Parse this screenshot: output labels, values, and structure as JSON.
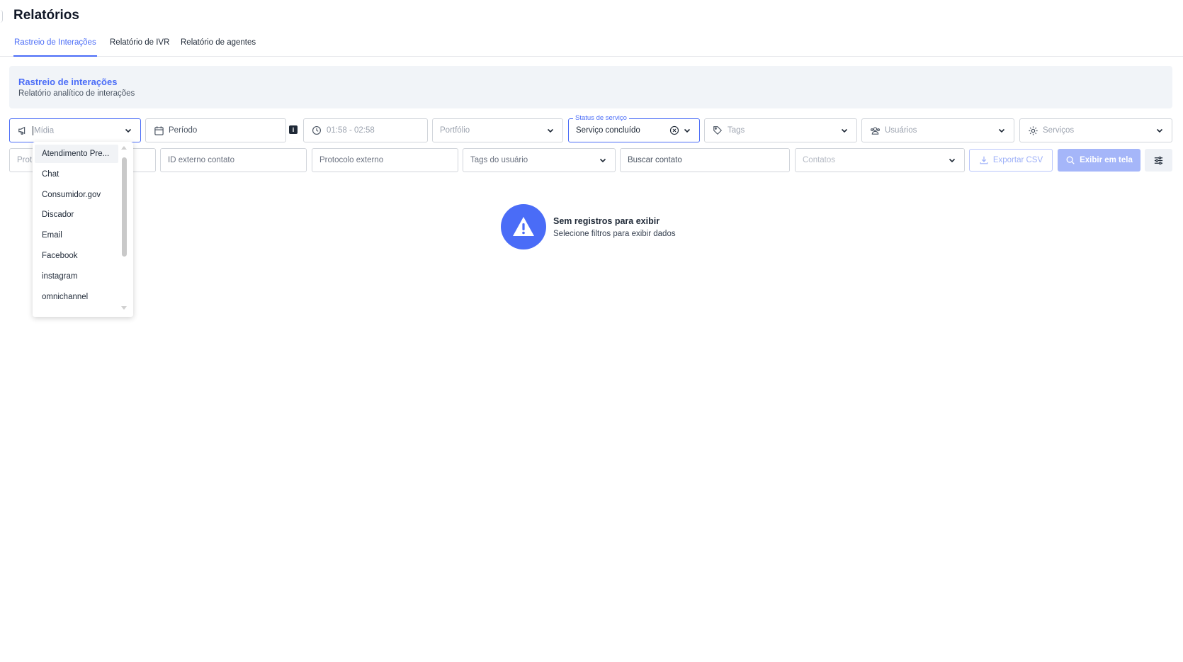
{
  "page": {
    "title": "Relatórios"
  },
  "tabs": [
    {
      "label": "Rastreio de Interações",
      "active": true
    },
    {
      "label": "Relatório de IVR",
      "active": false
    },
    {
      "label": "Relatório de agentes",
      "active": false
    }
  ],
  "card": {
    "title": "Rastreio de interações",
    "subtitle": "Relatório analítico de interações"
  },
  "filters": {
    "midia": {
      "placeholder": "Mídia",
      "icon": "megaphone-icon"
    },
    "periodo": {
      "placeholder": "Período",
      "icon": "calendar-icon",
      "info_badge": "i"
    },
    "horario": {
      "value": "01:58 - 02:58",
      "icon": "clock-icon"
    },
    "portfolio": {
      "placeholder": "Portfólio"
    },
    "status_servico": {
      "label": "Status de serviço",
      "value": "Serviço concluído"
    },
    "tags": {
      "placeholder": "Tags",
      "icon": "tag-icon"
    },
    "usuarios": {
      "placeholder": "Usuários",
      "icon": "users-icon"
    },
    "servicos": {
      "placeholder": "Serviços",
      "icon": "gear-icon"
    },
    "protocolo": {
      "placeholder": "Prot"
    },
    "id_externo": {
      "placeholder": "ID externo contato"
    },
    "protocolo_externo": {
      "placeholder": "Protocolo externo"
    },
    "tags_usuario": {
      "placeholder": "Tags do usuário"
    },
    "buscar_contato": {
      "placeholder": "Buscar contato"
    },
    "contatos": {
      "placeholder": "Contatos"
    }
  },
  "actions": {
    "export_label": "Exportar CSV",
    "show_label": "Exibir em tela"
  },
  "dropdown": {
    "items": [
      "Atendimento Pre...",
      "Chat",
      "Consumidor.gov",
      "Discador",
      "Email",
      "Facebook",
      "instagram",
      "omnichannel"
    ]
  },
  "empty_state": {
    "title": "Sem registros para exibir",
    "subtitle": "Selecione filtros para exibir dados"
  },
  "colors": {
    "accent": "#4a6cf7",
    "card_bg": "#f1f4f8"
  }
}
